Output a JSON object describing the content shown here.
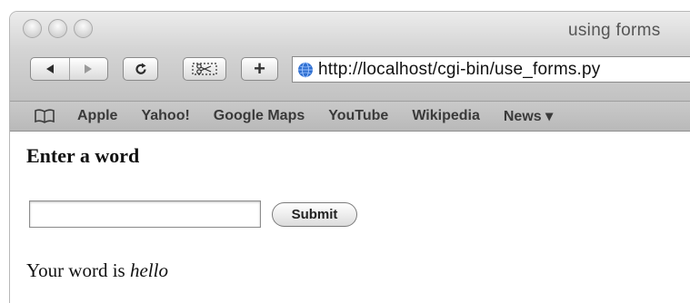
{
  "window": {
    "title": "using forms"
  },
  "toolbar": {
    "back_icon": "back-arrow-icon",
    "forward_icon": "forward-arrow-icon",
    "reload_icon": "reload-icon",
    "snippet_icon": "web-clip-icon",
    "add_icon": "add-bookmark-icon",
    "add_label": "+",
    "url": "http://localhost/cgi-bin/use_forms.py"
  },
  "bookmarks": {
    "items": [
      "Apple",
      "Yahoo!",
      "Google Maps",
      "YouTube",
      "Wikipedia",
      "News ▾"
    ]
  },
  "page": {
    "heading": "Enter a word",
    "input_value": "",
    "submit_label": "Submit",
    "result_prefix": "Your word is ",
    "result_word": "hello"
  },
  "colors": {
    "chrome_light": "#ececec",
    "chrome_dark": "#c2c2c2",
    "globe_blue": "#2f6fd0"
  }
}
